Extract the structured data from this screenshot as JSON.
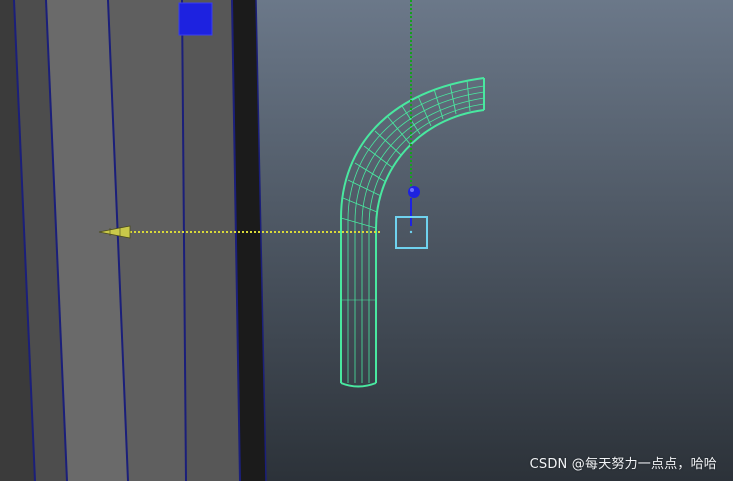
{
  "viewport": {
    "background_top": "#6b7889",
    "background_bottom": "#2c3239",
    "wireframe_color": "#49e8a0",
    "edge_color": "#1b1f7a",
    "selection_color": "#1d22e0",
    "manipulator_y_color": "#14a01e",
    "manipulator_x_color": "#d9d93a",
    "pivot_box_color": "#6fd2ef",
    "icons": {
      "move_handle": "blue-sphere-icon",
      "pivot": "pivot-box-icon",
      "axis_tip": "cone-arrow-icon"
    }
  },
  "watermark": {
    "text": "CSDN @每天努力一点点，哈哈"
  }
}
